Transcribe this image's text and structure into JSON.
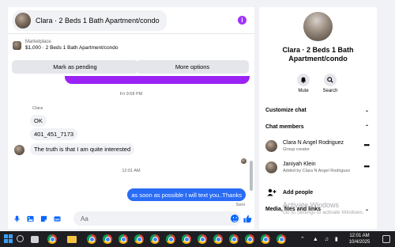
{
  "chat": {
    "title": "Clara · 2 Beds 1 Bath Apartment/condo",
    "marketplace_label": "Marketplace",
    "marketplace_item": "$1,000 · 2 Beds 1 Bath Apartment/condo",
    "mark_pending_label": "Mark as pending",
    "more_options_label": "More options",
    "time_separator_1": "Fri 9:58 PM",
    "sender_name": "Clara",
    "messages_in": [
      "OK",
      "401_451_7173",
      "The truth is that I am quite interested"
    ],
    "time_separator_2": "12:01 AM",
    "message_out": "as soon as possible I will text you..Thanks",
    "sent_label": "Sent",
    "composer_placeholder": "Aa"
  },
  "info": {
    "name": "Clara · 2 Beds 1 Bath Apartment/condo",
    "mute_label": "Mute",
    "search_label": "Search",
    "customize_label": "Customize chat",
    "members_label": "Chat members",
    "members": [
      {
        "name": "Clara N Angel Rodriguez",
        "subtitle": "Group creator"
      },
      {
        "name": "Janiyah Klein",
        "subtitle": "Added by Clara N Angel Rodriguez"
      }
    ],
    "add_people_label": "Add people",
    "media_label": "Media, files and links"
  },
  "overlay": {
    "activate_title": "Activate Windows",
    "activate_sub": "Go to Settings to activate Windows."
  },
  "taskbar": {
    "time": "12:01 AM",
    "date": "10/4/2025"
  },
  "colors": {
    "accent_blue": "#2a6cf4",
    "accent_purple": "#9b22f5",
    "panel_bg": "#ffffff",
    "page_bg": "#f0f2f5"
  }
}
